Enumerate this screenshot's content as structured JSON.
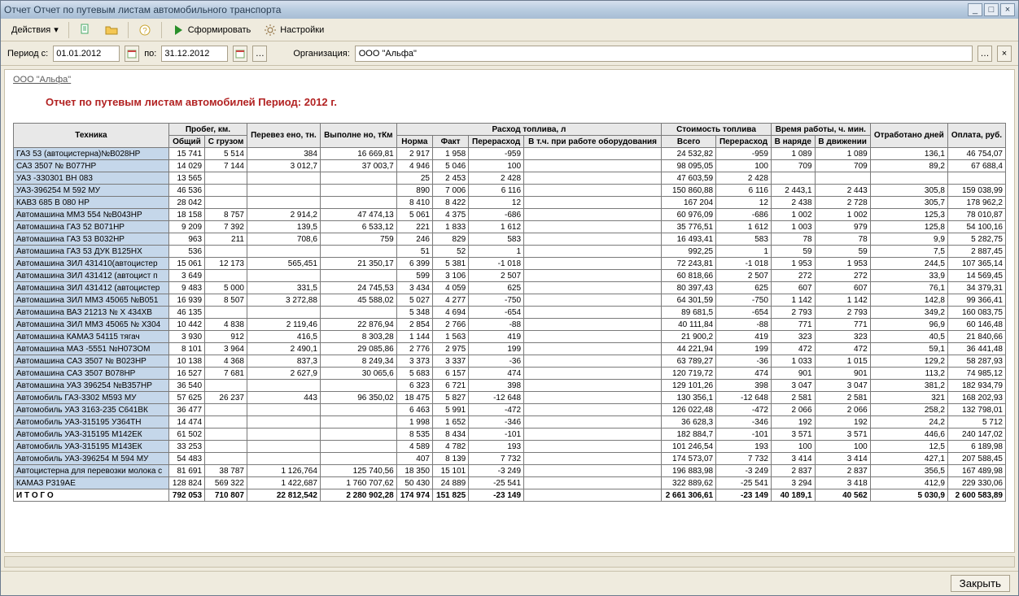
{
  "window": {
    "title": "Отчет  Отчет по путевым листам автомобильного транспорта"
  },
  "toolbar": {
    "actions": "Действия",
    "form": "Сформировать",
    "settings": "Настройки"
  },
  "params": {
    "period_label": "Период с:",
    "date_from": "01.01.2012",
    "to_label": "по:",
    "date_to": "31.12.2012",
    "org_label": "Организация:",
    "org_value": "ООО \"Альфа\""
  },
  "report": {
    "org_link": "ООО \"Альфа\"",
    "title": "Отчет по путевым листам автомобилей  Период: 2012 г.",
    "cols": {
      "tech": "Техника",
      "probeg": "Пробег, км.",
      "probeg_total": "Общий",
      "probeg_load": "С грузом",
      "transported": "Перевез ено, тн.",
      "work": "Выполне но, тКм",
      "fuel": "Расход топлива, л",
      "fuel_norm": "Норма",
      "fuel_fact": "Факт",
      "fuel_over": "Перерасход",
      "fuel_equip": "В т.ч. при работе оборудования",
      "cost": "Стоимость топлива",
      "cost_total": "Всего",
      "cost_over": "Перерасход",
      "time": "Время работы, ч. мин.",
      "time_duty": "В наряде",
      "time_move": "В движении",
      "days": "Отработано дней",
      "pay": "Оплата, руб.",
      "total": "И Т О Г О"
    },
    "rows": [
      {
        "n": "ГАЗ 53 (автоцистерна)№В028НР",
        "p1": "15 741",
        "p2": "5 514",
        "tr": "384",
        "wk": "16 669,81",
        "fn": "2 917",
        "ff": "1 958",
        "fo": "-959",
        "fe": "",
        "ct": "24 532,82",
        "co": "-959",
        "td": "1 089",
        "tm": "1 089",
        "d": "136,1",
        "py": "46 754,07"
      },
      {
        "n": "САЗ 3507  № В077НР",
        "p1": "14 029",
        "p2": "7 144",
        "tr": "3 012,7",
        "wk": "37 003,7",
        "fn": "4 946",
        "ff": "5 046",
        "fo": "100",
        "fe": "",
        "ct": "98 095,05",
        "co": "100",
        "td": "709",
        "tm": "709",
        "d": "89,2",
        "py": "67 688,4"
      },
      {
        "n": "УАЗ -330301 ВН 083",
        "p1": "13 565",
        "p2": "",
        "tr": "",
        "wk": "",
        "fn": "25",
        "ff": "2 453",
        "fo": "2 428",
        "fe": "",
        "ct": "47 603,59",
        "co": "2 428",
        "td": "",
        "tm": "",
        "d": "",
        "py": ""
      },
      {
        "n": "УАЗ-396254  М 592 МУ",
        "p1": "46 536",
        "p2": "",
        "tr": "",
        "wk": "",
        "fn": "890",
        "ff": "7 006",
        "fo": "6 116",
        "fe": "",
        "ct": "150 860,88",
        "co": "6 116",
        "td": "2 443,1",
        "tm": "2 443",
        "d": "305,8",
        "py": "159 038,99"
      },
      {
        "n": "КАВЗ 685  В 080 НР",
        "p1": "28 042",
        "p2": "",
        "tr": "",
        "wk": "",
        "fn": "8 410",
        "ff": "8 422",
        "fo": "12",
        "fe": "",
        "ct": "167 204",
        "co": "12",
        "td": "2 438",
        "tm": "2 728",
        "d": "305,7",
        "py": "178 962,2"
      },
      {
        "n": "Автомашина   ММЗ 554  №В043НР",
        "p1": "18 158",
        "p2": "8 757",
        "tr": "2 914,2",
        "wk": "47 474,13",
        "fn": "5 061",
        "ff": "4 375",
        "fo": "-686",
        "fe": "",
        "ct": "60 976,09",
        "co": "-686",
        "td": "1 002",
        "tm": "1 002",
        "d": "125,3",
        "py": "78 010,87"
      },
      {
        "n": "Автомашина  ГАЗ 52  В071НР",
        "p1": "9 209",
        "p2": "7 392",
        "tr": "139,5",
        "wk": "6 533,12",
        "fn": "221",
        "ff": "1 833",
        "fo": "1 612",
        "fe": "",
        "ct": "35 776,51",
        "co": "1 612",
        "td": "1 003",
        "tm": "979",
        "d": "125,8",
        "py": "54 100,16"
      },
      {
        "n": "Автомашина  ГАЗ 53  В032НР",
        "p1": "963",
        "p2": "211",
        "tr": "708,6",
        "wk": "759",
        "fn": "246",
        "ff": "829",
        "fo": "583",
        "fe": "",
        "ct": "16 493,41",
        "co": "583",
        "td": "78",
        "tm": "78",
        "d": "9,9",
        "py": "5 282,75"
      },
      {
        "n": "Автомашина  ГАЗ 53  ДУК  В125НХ",
        "p1": "536",
        "p2": "",
        "tr": "",
        "wk": "",
        "fn": "51",
        "ff": "52",
        "fo": "1",
        "fe": "",
        "ct": "992,25",
        "co": "1",
        "td": "59",
        "tm": "59",
        "d": "7,5",
        "py": "2 887,45"
      },
      {
        "n": "Автомашина  ЗИЛ 431410(автоцистер",
        "p1": "15 061",
        "p2": "12 173",
        "tr": "565,451",
        "wk": "21 350,17",
        "fn": "6 399",
        "ff": "5 381",
        "fo": "-1 018",
        "fe": "",
        "ct": "72 243,81",
        "co": "-1 018",
        "td": "1 953",
        "tm": "1 953",
        "d": "244,5",
        "py": "107 365,14"
      },
      {
        "n": "Автомашина  ЗИЛ 431412 (автоцист п",
        "p1": "3 649",
        "p2": "",
        "tr": "",
        "wk": "",
        "fn": "599",
        "ff": "3 106",
        "fo": "2 507",
        "fe": "",
        "ct": "60 818,66",
        "co": "2 507",
        "td": "272",
        "tm": "272",
        "d": "33,9",
        "py": "14 569,45"
      },
      {
        "n": "Автомашина  ЗИЛ 431412 (автоцистер",
        "p1": "9 483",
        "p2": "5 000",
        "tr": "331,5",
        "wk": "24 745,53",
        "fn": "3 434",
        "ff": "4 059",
        "fo": "625",
        "fe": "",
        "ct": "80 397,43",
        "co": "625",
        "td": "607",
        "tm": "607",
        "d": "76,1",
        "py": "34 379,31"
      },
      {
        "n": "Автомашина  ЗИЛ ММЗ 45065 №В051",
        "p1": "16 939",
        "p2": "8 507",
        "tr": "3 272,88",
        "wk": "45 588,02",
        "fn": "5 027",
        "ff": "4 277",
        "fo": "-750",
        "fe": "",
        "ct": "64 301,59",
        "co": "-750",
        "td": "1 142",
        "tm": "1 142",
        "d": "142,8",
        "py": "99 366,41"
      },
      {
        "n": "Автомашина ВАЗ 21213 № Х 434ХВ",
        "p1": "46 135",
        "p2": "",
        "tr": "",
        "wk": "",
        "fn": "5 348",
        "ff": "4 694",
        "fo": "-654",
        "fe": "",
        "ct": "89 681,5",
        "co": "-654",
        "td": "2 793",
        "tm": "2 793",
        "d": "349,2",
        "py": "160 083,75"
      },
      {
        "n": "Автомашина ЗИЛ ММЗ 45065  № Х304",
        "p1": "10 442",
        "p2": "4 838",
        "tr": "2 119,46",
        "wk": "22 876,94",
        "fn": "2 854",
        "ff": "2 766",
        "fo": "-88",
        "fe": "",
        "ct": "40 111,84",
        "co": "-88",
        "td": "771",
        "tm": "771",
        "d": "96,9",
        "py": "60 146,48"
      },
      {
        "n": "Автомашина КАМАЗ 54115 тягач",
        "p1": "3 930",
        "p2": "912",
        "tr": "416,5",
        "wk": "8 303,28",
        "fn": "1 144",
        "ff": "1 563",
        "fo": "419",
        "fe": "",
        "ct": "21 900,2",
        "co": "419",
        "td": "323",
        "tm": "323",
        "d": "40,5",
        "py": "21 840,66"
      },
      {
        "n": "Автомашина МАЗ -5551  №Н073ОМ",
        "p1": "8 101",
        "p2": "3 964",
        "tr": "2 490,1",
        "wk": "29 085,86",
        "fn": "2 776",
        "ff": "2 975",
        "fo": "199",
        "fe": "",
        "ct": "44 221,94",
        "co": "199",
        "td": "472",
        "tm": "472",
        "d": "59,1",
        "py": "36 441,48"
      },
      {
        "n": "Автомашина САЗ 3507  № В023НР",
        "p1": "10 138",
        "p2": "4 368",
        "tr": "837,3",
        "wk": "8 249,34",
        "fn": "3 373",
        "ff": "3 337",
        "fo": "-36",
        "fe": "",
        "ct": "63 789,27",
        "co": "-36",
        "td": "1 033",
        "tm": "1 015",
        "d": "129,2",
        "py": "58 287,93"
      },
      {
        "n": "Автомашина САЗ 3507 В078НР",
        "p1": "16 527",
        "p2": "7 681",
        "tr": "2 627,9",
        "wk": "30 065,6",
        "fn": "5 683",
        "ff": "6 157",
        "fo": "474",
        "fe": "",
        "ct": "120 719,72",
        "co": "474",
        "td": "901",
        "tm": "901",
        "d": "113,2",
        "py": "74 985,12"
      },
      {
        "n": "Автомашина УАЗ 396254  №В357НР",
        "p1": "36 540",
        "p2": "",
        "tr": "",
        "wk": "",
        "fn": "6 323",
        "ff": "6 721",
        "fo": "398",
        "fe": "",
        "ct": "129 101,26",
        "co": "398",
        "td": "3 047",
        "tm": "3 047",
        "d": "381,2",
        "py": "182 934,79"
      },
      {
        "n": "Автомобиль ГАЗ-3302  М593 МУ",
        "p1": "57 625",
        "p2": "26 237",
        "tr": "443",
        "wk": "96 350,02",
        "fn": "18 475",
        "ff": "5 827",
        "fo": "-12 648",
        "fe": "",
        "ct": "130 356,1",
        "co": "-12 648",
        "td": "2 581",
        "tm": "2 581",
        "d": "321",
        "py": "168 202,93"
      },
      {
        "n": "Автомобиль УАЗ 3163-235 С641ВК",
        "p1": "36 477",
        "p2": "",
        "tr": "",
        "wk": "",
        "fn": "6 463",
        "ff": "5 991",
        "fo": "-472",
        "fe": "",
        "ct": "126 022,48",
        "co": "-472",
        "td": "2 066",
        "tm": "2 066",
        "d": "258,2",
        "py": "132 798,01"
      },
      {
        "n": "Автомобиль УАЗ-315195  У364ТН",
        "p1": "14 474",
        "p2": "",
        "tr": "",
        "wk": "",
        "fn": "1 998",
        "ff": "1 652",
        "fo": "-346",
        "fe": "",
        "ct": "36 628,3",
        "co": "-346",
        "td": "192",
        "tm": "192",
        "d": "24,2",
        "py": "5 712"
      },
      {
        "n": "Автомобиль УАЗ-315195 М142ЕК",
        "p1": "61 502",
        "p2": "",
        "tr": "",
        "wk": "",
        "fn": "8 535",
        "ff": "8 434",
        "fo": "-101",
        "fe": "",
        "ct": "182 884,7",
        "co": "-101",
        "td": "3 571",
        "tm": "3 571",
        "d": "446,6",
        "py": "240 147,02"
      },
      {
        "n": "Автомобиль УАЗ-315195 М143ЕК",
        "p1": "33 253",
        "p2": "",
        "tr": "",
        "wk": "",
        "fn": "4 589",
        "ff": "4 782",
        "fo": "193",
        "fe": "",
        "ct": "101 246,54",
        "co": "193",
        "td": "100",
        "tm": "100",
        "d": "12,5",
        "py": "6 189,98"
      },
      {
        "n": "Автомобиль УАЗ-396254  М 594 МУ",
        "p1": "54 483",
        "p2": "",
        "tr": "",
        "wk": "",
        "fn": "407",
        "ff": "8 139",
        "fo": "7 732",
        "fe": "",
        "ct": "174 573,07",
        "co": "7 732",
        "td": "3 414",
        "tm": "3 414",
        "d": "427,1",
        "py": "207 588,45"
      },
      {
        "n": "Автоцистерна для перевозки  молока с",
        "p1": "81 691",
        "p2": "38 787",
        "tr": "1 126,764",
        "wk": "125 740,56",
        "fn": "18 350",
        "ff": "15 101",
        "fo": "-3 249",
        "fe": "",
        "ct": "196 883,98",
        "co": "-3 249",
        "td": "2 837",
        "tm": "2 837",
        "d": "356,5",
        "py": "167 489,98"
      },
      {
        "n": "КАМАЗ  Р319АЕ",
        "p1": "128 824",
        "p2": "569 322",
        "tr": "1 422,687",
        "wk": "1 760 707,62",
        "fn": "50 430",
        "ff": "24 889",
        "fo": "-25 541",
        "fe": "",
        "ct": "322 889,62",
        "co": "-25 541",
        "td": "3 294",
        "tm": "3 418",
        "d": "412,9",
        "py": "229 330,06"
      }
    ],
    "total": {
      "p1": "792 053",
      "p2": "710 807",
      "tr": "22 812,542",
      "wk": "2 280 902,28",
      "fn": "174 974",
      "ff": "151 825",
      "fo": "-23 149",
      "fe": "",
      "ct": "2 661 306,61",
      "co": "-23 149",
      "td": "40 189,1",
      "tm": "40 562",
      "d": "5 030,9",
      "py": "2 600 583,89"
    }
  },
  "footer": {
    "close": "Закрыть"
  }
}
